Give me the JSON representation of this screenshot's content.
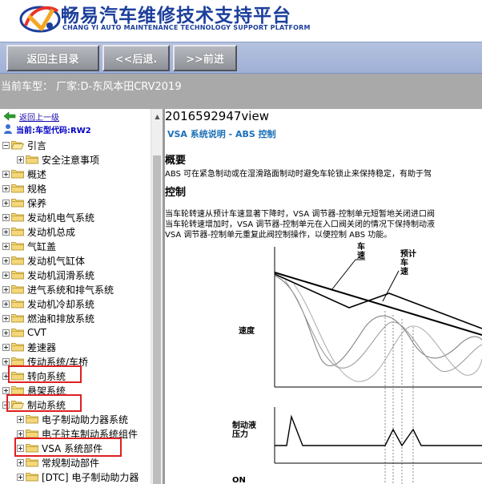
{
  "header": {
    "title": "畅易汽车维修技术支持平台",
    "subtitle": "CHANG YI AUTO MAINTENANCE TECHNOLOGY SUPPORT PLATFORM",
    "logo_icon": "chang-yi-logo",
    "accent_color": "#1c3f9c"
  },
  "nav": {
    "back_home": "返回主目录",
    "prev": "<<后退.",
    "next": ">>前进"
  },
  "vehicle": {
    "text": "当前车型： 厂家:D-东风本田CRV2019"
  },
  "tree": {
    "back_up": "返回上一级",
    "current_code": "当前:车型代码:RW2",
    "items": [
      {
        "label": "引言",
        "level": 0,
        "expanded": true
      },
      {
        "label": "安全注意事项",
        "level": 1,
        "expanded": false
      },
      {
        "label": "概述",
        "level": 0,
        "expanded": false
      },
      {
        "label": "规格",
        "level": 0,
        "expanded": false
      },
      {
        "label": "保养",
        "level": 0,
        "expanded": false
      },
      {
        "label": "发动机电气系统",
        "level": 0,
        "expanded": false
      },
      {
        "label": "发动机总成",
        "level": 0,
        "expanded": false
      },
      {
        "label": "气缸盖",
        "level": 0,
        "expanded": false
      },
      {
        "label": "发动机气缸体",
        "level": 0,
        "expanded": false
      },
      {
        "label": "发动机润滑系统",
        "level": 0,
        "expanded": false
      },
      {
        "label": "进气系统和排气系统",
        "level": 0,
        "expanded": false
      },
      {
        "label": "发动机冷却系统",
        "level": 0,
        "expanded": false
      },
      {
        "label": "燃油和排放系统",
        "level": 0,
        "expanded": false
      },
      {
        "label": "CVT",
        "level": 0,
        "expanded": false
      },
      {
        "label": "差速器",
        "level": 0,
        "expanded": false
      },
      {
        "label": "传动系统/车桥",
        "level": 0,
        "expanded": false
      },
      {
        "label": "转向系统",
        "level": 0,
        "expanded": false,
        "highlighted": true
      },
      {
        "label": "悬架系统",
        "level": 0,
        "expanded": false
      },
      {
        "label": "制动系统",
        "level": 0,
        "expanded": true,
        "highlighted": true
      },
      {
        "label": "电子制动助力器系统",
        "level": 1,
        "expanded": false
      },
      {
        "label": "电子驻车制动系统组件",
        "level": 1,
        "expanded": false
      },
      {
        "label": "VSA 系统部件",
        "level": 1,
        "expanded": false,
        "highlighted": true
      },
      {
        "label": "常规制动部件",
        "level": 1,
        "expanded": false
      },
      {
        "label": "[DTC] 电子制动助力器",
        "level": 1,
        "expanded": false
      }
    ]
  },
  "content": {
    "doc_id": "2016592947view",
    "title": "VSA 系统说明 - ABS 控制",
    "overview_heading": "概要",
    "overview_text": "ABS 可在紧急制动或在湿滑路面制动时避免车轮锁止来保持稳定，有助于驾",
    "control_heading": "控制",
    "control_lines": [
      "当车轮转速从预计车速显著下降时，VSA 调节器-控制单元短暂地关闭进口阀",
      "当车轮转速增加时，VSA 调节器-控制单元在入口阀关闭的情况下保持制动液",
      "VSA 调节器-控制单元重复此阀控制操作，以便控制 ABS 功能。"
    ],
    "diagram": {
      "label_vehicle_speed": "车\n速",
      "label_estimated_speed": "预计\n车\n速",
      "label_speed": "速度",
      "label_pressure": "制动液\n压力",
      "label_on": "ON"
    }
  }
}
